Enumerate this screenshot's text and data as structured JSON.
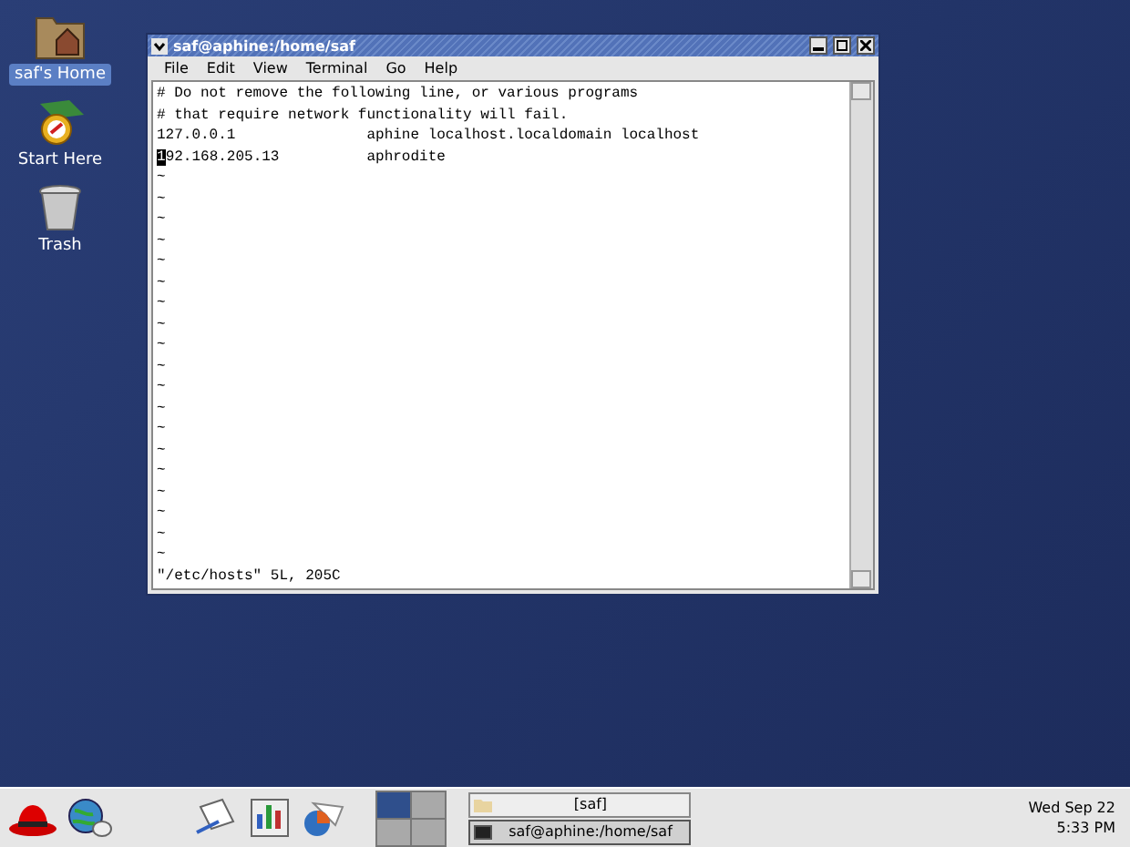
{
  "desktop_icons": [
    {
      "label": "saf's Home",
      "kind": "home",
      "selected": true
    },
    {
      "label": "Start Here",
      "kind": "start",
      "selected": false
    },
    {
      "label": "Trash",
      "kind": "trash",
      "selected": false
    }
  ],
  "window": {
    "title": "saf@aphine:/home/saf",
    "menu": [
      "File",
      "Edit",
      "View",
      "Terminal",
      "Go",
      "Help"
    ],
    "lines": [
      {
        "text": "# Do not remove the following line, or various programs",
        "cursor": false
      },
      {
        "text": "# that require network functionality will fail.",
        "cursor": false
      },
      {
        "text": "127.0.0.1               aphine localhost.localdomain localhost",
        "cursor": false
      },
      {
        "text": "192.168.205.13          aphrodite",
        "cursor": true
      }
    ],
    "tildes": [
      "~",
      "~",
      "~",
      "~",
      "~",
      "~",
      "~",
      "~",
      "~",
      "~",
      "~",
      "~",
      "~",
      "~",
      "~",
      "~",
      "~",
      "~",
      "~"
    ],
    "status_line": "\"/etc/hosts\" 5L, 205C"
  },
  "taskbar": {
    "pager": [
      {
        "selected": true
      },
      {
        "selected": false
      },
      {
        "selected": false
      },
      {
        "selected": false
      }
    ],
    "tasks": [
      {
        "label": "[saf]",
        "kind": "folder",
        "selected": false
      },
      {
        "label": "saf@aphine:/home/saf",
        "kind": "terminal",
        "selected": true
      }
    ],
    "clock": [
      "Wed Sep 22",
      "5:33 PM"
    ]
  }
}
